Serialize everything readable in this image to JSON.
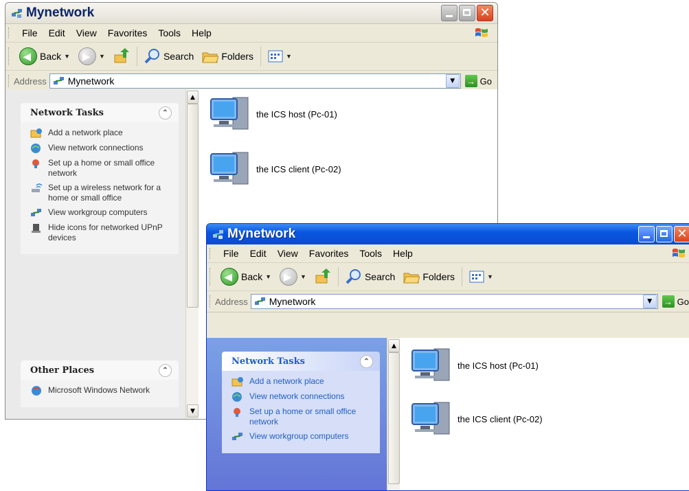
{
  "colors": {
    "xp_blue": "#0b4bd1",
    "link_blue": "#215dc6",
    "task_pane_blue": "#6375d6"
  },
  "back_window": {
    "title": "Mynetwork",
    "menu": [
      "File",
      "Edit",
      "View",
      "Favorites",
      "Tools",
      "Help"
    ],
    "toolbar": {
      "back": "Back",
      "search": "Search",
      "folders": "Folders"
    },
    "address": {
      "label": "Address",
      "value": "Mynetwork",
      "go": "Go"
    },
    "panels": [
      {
        "title": "Network Tasks",
        "tasks": [
          {
            "icon": "add-network-place-icon",
            "label": "Add a network place"
          },
          {
            "icon": "network-connections-icon",
            "label": "View network connections"
          },
          {
            "icon": "home-network-icon",
            "label": "Set up a home or small office network"
          },
          {
            "icon": "wireless-icon",
            "label": "Set up a wireless network for a home or small office"
          },
          {
            "icon": "workgroup-icon",
            "label": "View workgroup computers"
          },
          {
            "icon": "upnp-icon",
            "label": "Hide icons for networked UPnP devices"
          }
        ]
      },
      {
        "title": "Other Places",
        "tasks": [
          {
            "icon": "windows-network-icon",
            "label": "Microsoft Windows Network"
          }
        ]
      }
    ],
    "items": [
      {
        "label": "the ICS host (Pc-01)"
      },
      {
        "label": "the ICS client (Pc-02)"
      }
    ]
  },
  "front_window": {
    "title": "Mynetwork",
    "menu": [
      "File",
      "Edit",
      "View",
      "Favorites",
      "Tools",
      "Help"
    ],
    "toolbar": {
      "back": "Back",
      "search": "Search",
      "folders": "Folders"
    },
    "address": {
      "label": "Address",
      "value": "Mynetwork",
      "go": "Go"
    },
    "panels": [
      {
        "title": "Network Tasks",
        "tasks": [
          {
            "icon": "add-network-place-icon",
            "label": "Add a network place"
          },
          {
            "icon": "network-connections-icon",
            "label": "View network connections"
          },
          {
            "icon": "home-network-icon",
            "label": "Set up a home or small office network"
          },
          {
            "icon": "workgroup-icon",
            "label": "View workgroup computers"
          }
        ]
      }
    ],
    "items": [
      {
        "label": "the ICS host (Pc-01)"
      },
      {
        "label": "the ICS client (Pc-02)"
      }
    ]
  }
}
